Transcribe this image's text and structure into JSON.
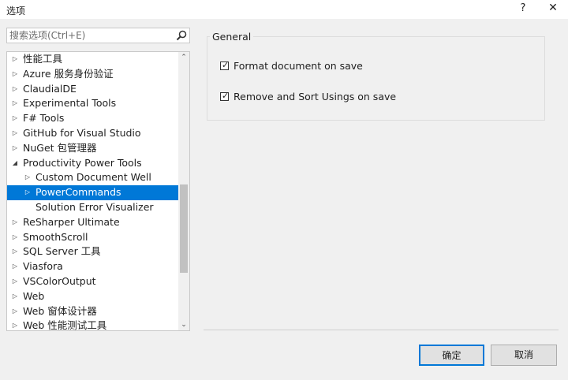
{
  "window": {
    "title": "选项",
    "help": "?",
    "close": "✕"
  },
  "search": {
    "placeholder": "搜索选项(Ctrl+E)"
  },
  "tree": {
    "items": [
      {
        "label": "性能工具",
        "level": 0,
        "arrow": "▷"
      },
      {
        "label": "Azure 服务身份验证",
        "level": 0,
        "arrow": "▷"
      },
      {
        "label": "ClaudialDE",
        "level": 0,
        "arrow": "▷"
      },
      {
        "label": "Experimental Tools",
        "level": 0,
        "arrow": "▷"
      },
      {
        "label": "F# Tools",
        "level": 0,
        "arrow": "▷"
      },
      {
        "label": "GitHub for Visual Studio",
        "level": 0,
        "arrow": "▷"
      },
      {
        "label": "NuGet 包管理器",
        "level": 0,
        "arrow": "▷"
      },
      {
        "label": "Productivity Power Tools",
        "level": 0,
        "arrow": "◢"
      },
      {
        "label": "Custom Document Well",
        "level": 1,
        "arrow": "▷"
      },
      {
        "label": "PowerCommands",
        "level": 1,
        "arrow": "▷",
        "selected": true
      },
      {
        "label": "Solution Error Visualizer",
        "level": 1,
        "arrow": ""
      },
      {
        "label": "ReSharper Ultimate",
        "level": 0,
        "arrow": "▷"
      },
      {
        "label": "SmoothScroll",
        "level": 0,
        "arrow": "▷"
      },
      {
        "label": "SQL Server 工具",
        "level": 0,
        "arrow": "▷"
      },
      {
        "label": "Viasfora",
        "level": 0,
        "arrow": "▷"
      },
      {
        "label": "VSColorOutput",
        "level": 0,
        "arrow": "▷"
      },
      {
        "label": "Web",
        "level": 0,
        "arrow": "▷"
      },
      {
        "label": "Web 窗体设计器",
        "level": 0,
        "arrow": "▷"
      },
      {
        "label": "Web 性能测试工具",
        "level": 0,
        "arrow": "▷"
      }
    ],
    "scroll_up": "⌃",
    "scroll_down": "⌄"
  },
  "general": {
    "title": "General",
    "options": [
      {
        "label": "Format document on save",
        "checked": true
      },
      {
        "label": "Remove and Sort Usings on save",
        "checked": true
      }
    ]
  },
  "buttons": {
    "ok": "确定",
    "cancel": "取消"
  },
  "colors": {
    "accent": "#0078d7",
    "window_bg": "#f0f0f0"
  }
}
